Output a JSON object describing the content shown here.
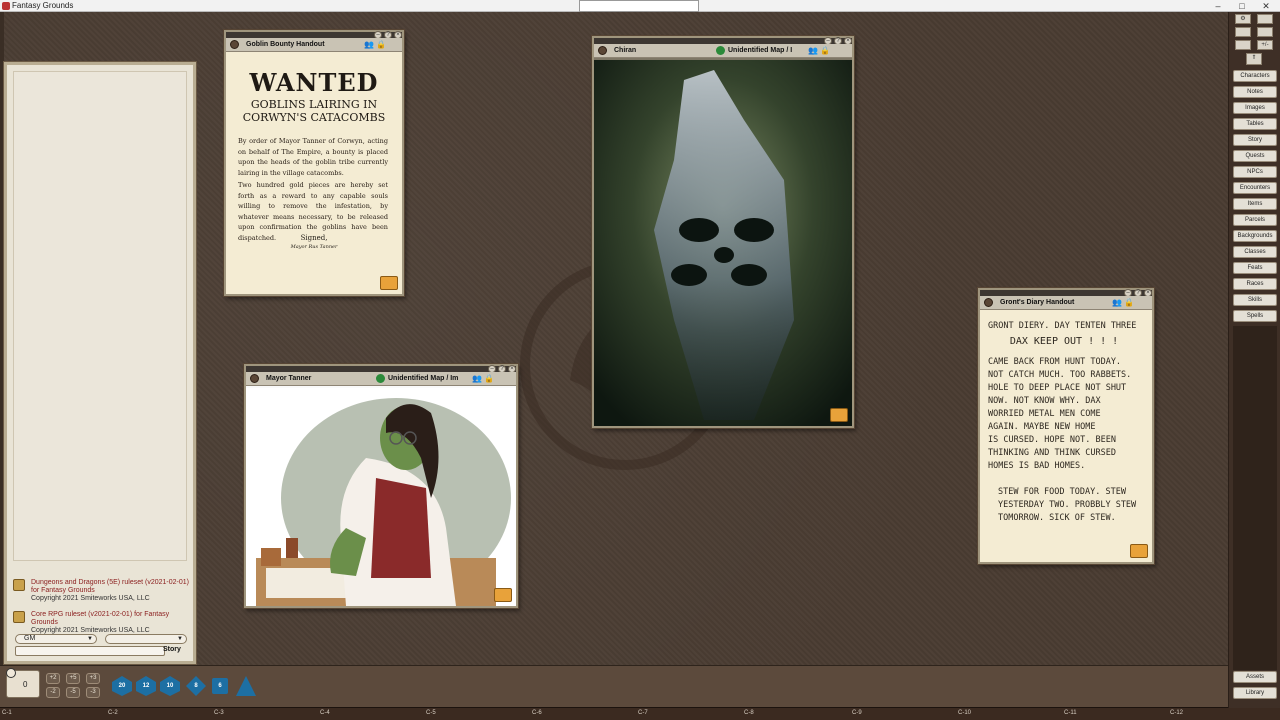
{
  "app": {
    "title": "Fantasy Grounds"
  },
  "chat": {
    "modules": [
      {
        "line1": "Dungeons and Dragons (5E) ruleset (v2021-02-01)",
        "line2": "for Fantasy Grounds",
        "line3": "Copyright 2021 Smiteworks USA, LLC"
      },
      {
        "line1": "Core RPG ruleset (v2021-02-01) for Fantasy Grounds",
        "line2": "Copyright 2021 Smiteworks USA, LLC"
      }
    ],
    "identity": "GM",
    "language": "",
    "story_label": "Story"
  },
  "modifier": {
    "value": "0"
  },
  "dice": [
    "20",
    "12",
    "10",
    "8",
    "6",
    ""
  ],
  "mod_buttons": [
    "+2",
    "+5",
    "+3",
    "-2",
    "-5",
    "-3"
  ],
  "coords": [
    "C-1",
    "C-2",
    "C-3",
    "C-4",
    "C-5",
    "C-6",
    "C-7",
    "C-8",
    "C-9",
    "C-10",
    "C-11",
    "C-12"
  ],
  "sidebar": {
    "tools": [
      "",
      "",
      "",
      "",
      "",
      "+/-",
      "",
      ""
    ],
    "tabs": [
      "Characters",
      "Notes",
      "Images",
      "Tables",
      "Story",
      "Quests",
      "NPCs",
      "Encounters",
      "Items",
      "Parcels",
      "Backgrounds",
      "Classes",
      "Feats",
      "Races",
      "Skills",
      "Spells"
    ],
    "bottom": [
      "Assets",
      "Library"
    ]
  },
  "windows": {
    "bounty": {
      "title": "Goblin Bounty Handout",
      "headline": "WANTED",
      "sub1": "GOBLINS LAIRING IN",
      "sub2": "CORWYN'S CATACOMBS",
      "p1": "By order of Mayor Tanner of Corwyn, acting on behalf of The Empire, a bounty is placed upon the heads of the goblin tribe currently lairing in the village catacombs.",
      "p2": "Two hundred gold pieces are hereby set forth as a reward to any capable souls willing to remove the infestation, by whatever means necessary, to be released upon confirmation the goblins have been dispatched.",
      "signed": "Signed,",
      "signature": "Mayor Rus Tanner"
    },
    "chiran": {
      "title": "Chiran",
      "status": "Unidentified Map / I"
    },
    "tanner": {
      "title": "Mayor Tanner",
      "status": "Unidentified Map / Im"
    },
    "diary": {
      "title": "Gront's Diary Handout",
      "lines": [
        "Gront Diery. Day Tenten three",
        "Dax keep out ! ! !",
        "Came back from hunt today.",
        "Not catch much. Too rabbets.",
        "Hole to deep place not shut",
        "now. Not know why. Dax",
        "worried metal men come",
        "again. Maybe new home",
        "is cursed. Hope not. Been",
        "thinking and think cursed",
        "homes is bad homes.",
        "",
        "Stew for food today. Stew",
        "yesterday two. Probbly stew",
        "tomorrow. Sick of stew."
      ]
    }
  }
}
